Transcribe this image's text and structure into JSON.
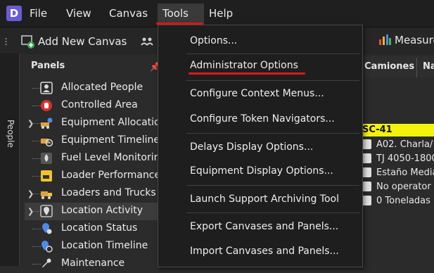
{
  "app": {
    "logo_letter": "D"
  },
  "menubar": {
    "items": [
      {
        "label": "File"
      },
      {
        "label": "View"
      },
      {
        "label": "Canvas"
      },
      {
        "label": "Tools"
      },
      {
        "label": "Help"
      }
    ]
  },
  "toolbar": {
    "add_canvas_label": "Add New Canvas",
    "measure_label": "Measure"
  },
  "sidebar": {
    "people_label": "People"
  },
  "panels": {
    "title": "Panels",
    "items": [
      {
        "label": "Allocated People",
        "icon": "person-badge-icon",
        "expandable": false
      },
      {
        "label": "Controlled Area",
        "icon": "stop-hand-icon",
        "expandable": false
      },
      {
        "label": "Equipment Allocation",
        "icon": "equipment-allocation-icon",
        "expandable": true
      },
      {
        "label": "Equipment Timeline",
        "icon": "equipment-timeline-icon",
        "expandable": false
      },
      {
        "label": "Fuel Level Monitoring",
        "icon": "fuel-icon",
        "expandable": false
      },
      {
        "label": "Loader Performance",
        "icon": "loader-icon",
        "expandable": false
      },
      {
        "label": "Loaders and Trucks",
        "icon": "loader-truck-icon",
        "expandable": true
      },
      {
        "label": "Location Activity",
        "icon": "location-activity-icon",
        "expandable": true,
        "selected": true
      },
      {
        "label": "Location Status",
        "icon": "location-status-icon",
        "expandable": false
      },
      {
        "label": "Location Timeline",
        "icon": "location-timeline-icon",
        "expandable": false
      },
      {
        "label": "Maintenance",
        "icon": "wrench-icon",
        "expandable": false
      }
    ]
  },
  "tabs": {
    "camiones": "Camiones",
    "next": "Na"
  },
  "card": {
    "title": "SC-41",
    "rows": [
      {
        "icon": "info-icon",
        "text": "A02. Charla/"
      },
      {
        "icon": "location-pin-icon",
        "text": "TJ 4050-1800"
      },
      {
        "icon": "terrain-icon",
        "text": "Estaño Media"
      },
      {
        "icon": "person-icon",
        "text": "No operator"
      },
      {
        "icon": "bar-chart-icon",
        "text": "0 Toneladas"
      }
    ]
  },
  "tools_menu": {
    "items": [
      {
        "label": "Options..."
      },
      {
        "label": "Administrator Options"
      },
      {
        "label": "Configure Context Menus..."
      },
      {
        "label": "Configure Token Navigators..."
      },
      {
        "label": "Delays Display Options..."
      },
      {
        "label": "Equipment Display Options..."
      },
      {
        "label": "Launch Support Archiving Tool"
      },
      {
        "label": "Export Canvases and Panels..."
      },
      {
        "label": "Import Canvases and Panels..."
      }
    ]
  },
  "colors": {
    "accent_underline": "#e01818",
    "card_title_bg": "#f2f20a",
    "logo_bg": "#6b5bd3"
  }
}
